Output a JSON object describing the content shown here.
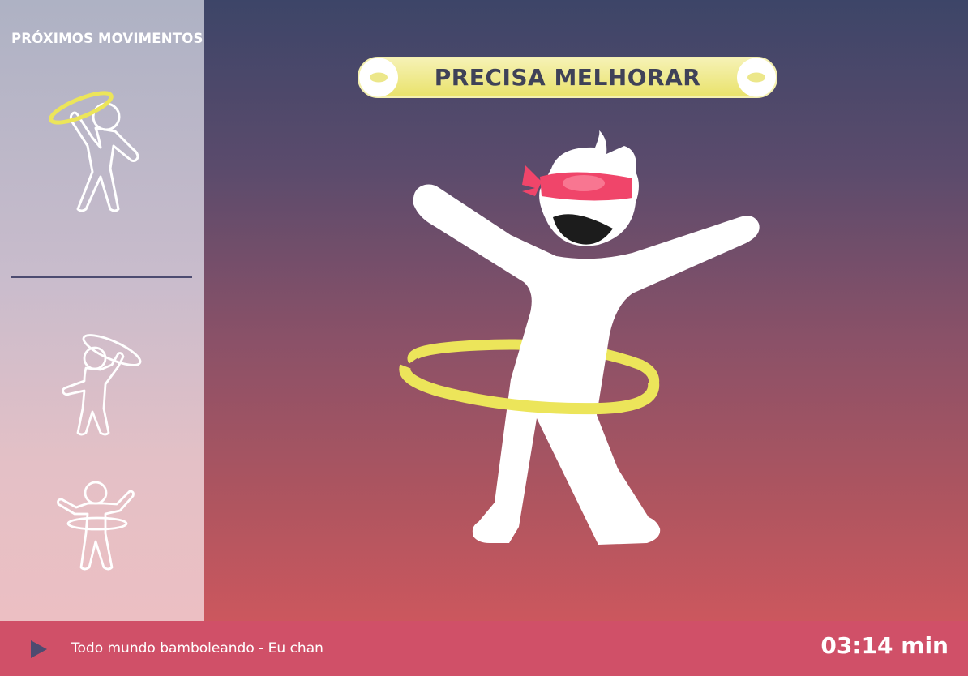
{
  "sidebar": {
    "title": "PRÓXIMOS MOVIMENTOS",
    "moves": [
      {
        "icon": "dancer-hoop-raised-icon"
      },
      {
        "icon": "dancer-hoop-overhead-icon"
      },
      {
        "icon": "dancer-hoop-waist-icon"
      }
    ]
  },
  "feedback": {
    "label": "PRECISA MELHORAR",
    "color": "#f0e98a"
  },
  "player": {
    "song": "Todo mundo bamboleando - Eu chan",
    "time": "03:14 min",
    "play_icon": "play-icon"
  },
  "colors": {
    "hoop": "#ece55a",
    "bandana": "#f0456a",
    "bottom_bar": "#d05068",
    "divider": "#4c4b70"
  }
}
